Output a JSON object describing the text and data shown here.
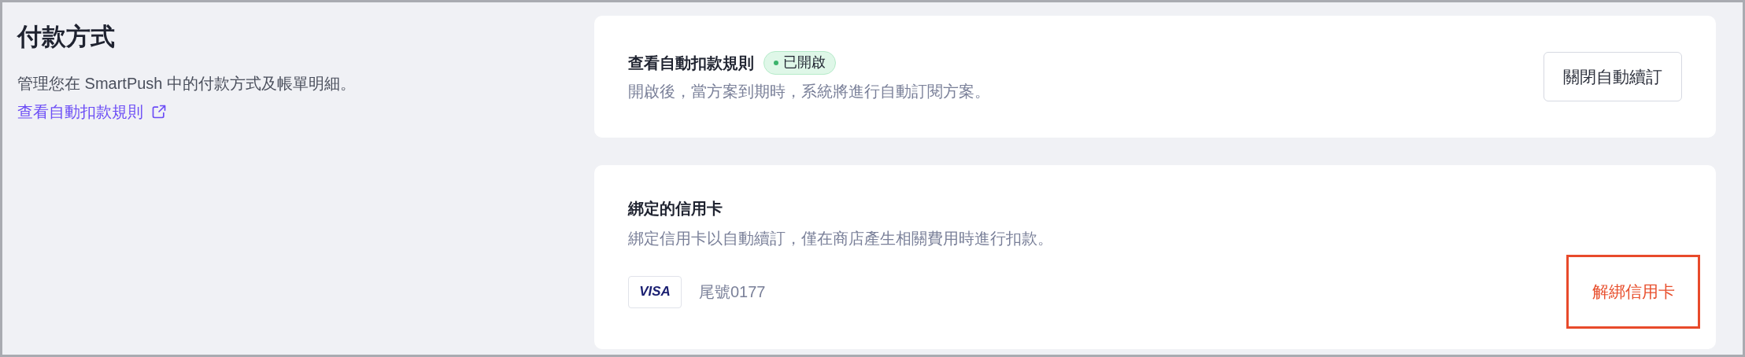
{
  "section": {
    "title": "付款方式",
    "description": "管理您在 SmartPush 中的付款方式及帳單明細。",
    "link": "查看自動扣款規則"
  },
  "auto_renew": {
    "title": "查看自動扣款規則",
    "badge": "已開啟",
    "description": "開啟後，當方案到期時，系統將進行自動訂閱方案。",
    "button": "關閉自動續訂"
  },
  "credit_card": {
    "title": "綁定的信用卡",
    "description": "綁定信用卡以自動續訂，僅在商店產生相關費用時進行扣款。",
    "card_brand": "VISA",
    "card_number": "尾號0177",
    "button": "解綁信用卡"
  }
}
